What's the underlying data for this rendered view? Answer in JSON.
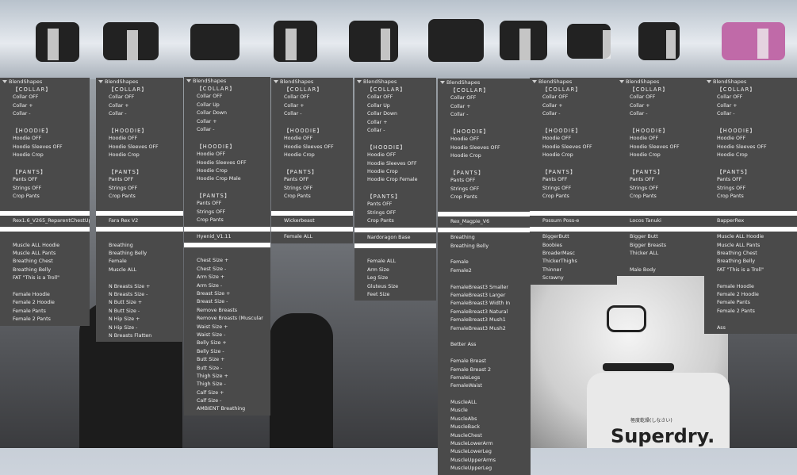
{
  "colors": {
    "panel": "#4a4a4a",
    "text": "#f0f0f0",
    "separator": "#ffffff"
  },
  "panels": [
    {
      "header": "BlendShapes",
      "rows": [
        "[COLLAR]",
        "Collar OFF",
        "Collar +",
        "Collar -",
        "",
        "[HOODIE]",
        "Hoodie OFF",
        "Hoodie Sleeves OFF",
        "Hoodie Crop",
        "",
        "[PANTS]",
        "Pants OFF",
        "Strings OFF",
        "Crop Pants",
        "",
        "|SEP|",
        "Rex1.6_V265_ReparentChestUp",
        "|SEP|",
        "",
        "Muscle ALL Hoodie",
        "Muscle ALL Pants",
        "Breathing Chest",
        "Breathing Belly",
        "FAT \"This is a Troll\"",
        "",
        "Female Hoodie",
        "Female 2 Hoodie",
        "Female Pants",
        "Female 2 Pants"
      ]
    },
    {
      "header": "BlendShapes",
      "rows": [
        "[COLLAR]",
        "Collar OFF",
        "Collar +",
        "Collar -",
        "",
        "[HOODIE]",
        "Hoodie OFF",
        "Hoodie Sleeves OFF",
        "Hoodie Crop",
        "",
        "[PANTS]",
        "Pants OFF",
        "Strings OFF",
        "Crop Pants",
        "",
        "|SEP|",
        "Fara Rex V2",
        "|SEP|",
        "",
        "Breathing",
        "Breathing Belly",
        "Female",
        "Muscle ALL",
        "",
        "N Breasts Size +",
        "N Breasts Size -",
        "N Butt Size +",
        "N Butt Size -",
        "N Hip Size +",
        "N Hip Size -",
        "N Breasts Flatten"
      ]
    },
    {
      "header": "BlendShapes",
      "rows": [
        "[COLLAR]",
        "Collar OFF",
        "Collar Up",
        "Collar Down",
        "Collar +",
        "Collar -",
        "",
        "[HOODIE]",
        "Hoodie OFF",
        "Hoodie Sleeves OFF",
        "Hoodie Crop",
        "Hoodie Crop Male",
        "",
        "[PANTS]",
        "Pants OFF",
        "Strings OFF",
        "Crop Pants",
        "|SEP|",
        "Hyenid_V1.11",
        "|SEP|",
        "",
        "Chest Size +",
        "Chest Size -",
        "Arm Size +",
        "Arm Size -",
        "Breast Size +",
        "Breast Size -",
        "Remove Breasts",
        "Remove Breasts (Muscular",
        "Waist Size +",
        "Waist Size -",
        "Belly Size +",
        "Belly Size -",
        "Butt Size +",
        "Butt Size -",
        "Thigh Size +",
        "Thigh Size -",
        "Calf Size +",
        "Calf Size -",
        "AMBIENT Breathing"
      ]
    },
    {
      "header": "BlendShapes",
      "rows": [
        "[COLLAR]",
        "Collar OFF",
        "Collar +",
        "Collar -",
        "",
        "[HOODIE]",
        "Hoodie OFF",
        "Hoodie Sleeves OFF",
        "Hoodie Crop",
        "",
        "[PANTS]",
        "Pants OFF",
        "Strings OFF",
        "Crop Pants",
        "",
        "|SEP|",
        "Wickerbeast",
        "|SEP|",
        "Female ALL"
      ]
    },
    {
      "header": "BlendShapes",
      "rows": [
        "[COLLAR]",
        "Collar OFF",
        "Collar Up",
        "Collar Down",
        "Collar +",
        "Collar -",
        "",
        "[HOODIE]",
        "Hoodie OFF",
        "Hoodie Sleeves OFF",
        "Hoodie Crop",
        "Hoodie Crop Female",
        "",
        "[PANTS]",
        "Pants OFF",
        "Strings OFF",
        "Crop Pants",
        "|SEP|",
        "Nardoragon Base",
        "|SEP|",
        "",
        "Female ALL",
        "Arm Size",
        "Leg Size",
        "Gluteus Size",
        "Feet Size"
      ]
    },
    {
      "header": "BlendShapes",
      "rows": [
        "[COLLAR]",
        "Collar OFF",
        "Collar +",
        "Collar -",
        "",
        "[HOODIE]",
        "Hoodie OFF",
        "Hoodie Sleeves OFF",
        "Hoodie Crop",
        "",
        "[PANTS]",
        "Pants OFF",
        "Strings OFF",
        "Crop Pants",
        "",
        "|SEP|",
        "Rex_Magpie_V6",
        "|SEP|",
        "Breathing",
        "Breathing Belly",
        "",
        "Female",
        "Female2",
        "",
        "FemaleBreast3 Smaller",
        "FemaleBreast3 Larger",
        "FemaleBreast3 Width In",
        "FemaleBreast3 Natural",
        "FemaleBreast3 Mush1",
        "FemaleBreast3 Mush2",
        "",
        "Better Ass",
        "",
        "Female Breast",
        "Female Breast 2",
        "FemaleLegs",
        "FemaleWaist",
        "",
        "MuscleALL",
        "Muscle",
        "MuscleAbs",
        "MuscleBack",
        "MuscleChest",
        "MuscleLowerArm",
        "MuscleLowerLeg",
        "MuscleUpperArms",
        "MuscleUpperLeg"
      ]
    },
    {
      "header": "BlendShapes",
      "rows": [
        "[COLLAR]",
        "Collar OFF",
        "Collar +",
        "Collar -",
        "",
        "[HOODIE]",
        "Hoodie OFF",
        "Hoodie Sleeves OFF",
        "Hoodie Crop",
        "",
        "[PANTS]",
        "Pants OFF",
        "Strings OFF",
        "Crop Pants",
        "",
        "|SEP|",
        "Possum Poss-e",
        "|SEP|",
        "BiggerButt",
        "Boobies",
        "BroaderMasc",
        "ThickerThighs",
        "Thinner",
        "Scrawny"
      ]
    },
    {
      "header": "BlendShapes",
      "rows": [
        "[COLLAR]",
        "Collar OFF",
        "Collar +",
        "Collar -",
        "",
        "[HOODIE]",
        "Hoodie OFF",
        "Hoodie Sleeves OFF",
        "Hoodie Crop",
        "",
        "[PANTS]",
        "Pants OFF",
        "Strings OFF",
        "Crop Pants",
        "",
        "|SEP|",
        "Locos Tanuki",
        "|SEP|",
        "Bigger Butt",
        "Bigger Breasts",
        "Thicker ALL",
        "",
        "Male Body"
      ]
    },
    {
      "header": "BlendShapes",
      "rows": [
        "[COLLAR]",
        "Collar OFF",
        "Collar +",
        "Collar -",
        "",
        "[HOODIE]",
        "Hoodie OFF",
        "Hoodie Sleeves OFF",
        "Hoodie Crop",
        "",
        "[PANTS]",
        "Pants OFF",
        "Strings OFF",
        "Crop Pants",
        "",
        "|SEP|",
        "BapperRex",
        "|SEP|",
        "Muscle ALL Hoodie",
        "Muscle ALL Pants",
        "Breathing Chest",
        "Breathing Belly",
        "FAT \"This is a Troll\"",
        "",
        "Female Hoodie",
        "Female 2 Hoodie",
        "Female Pants",
        "Female 2 Pants",
        "",
        "Ass"
      ]
    }
  ],
  "overlay_text": {
    "brand": "Superdry.",
    "jp": "極度乾燥(しなさい)"
  }
}
